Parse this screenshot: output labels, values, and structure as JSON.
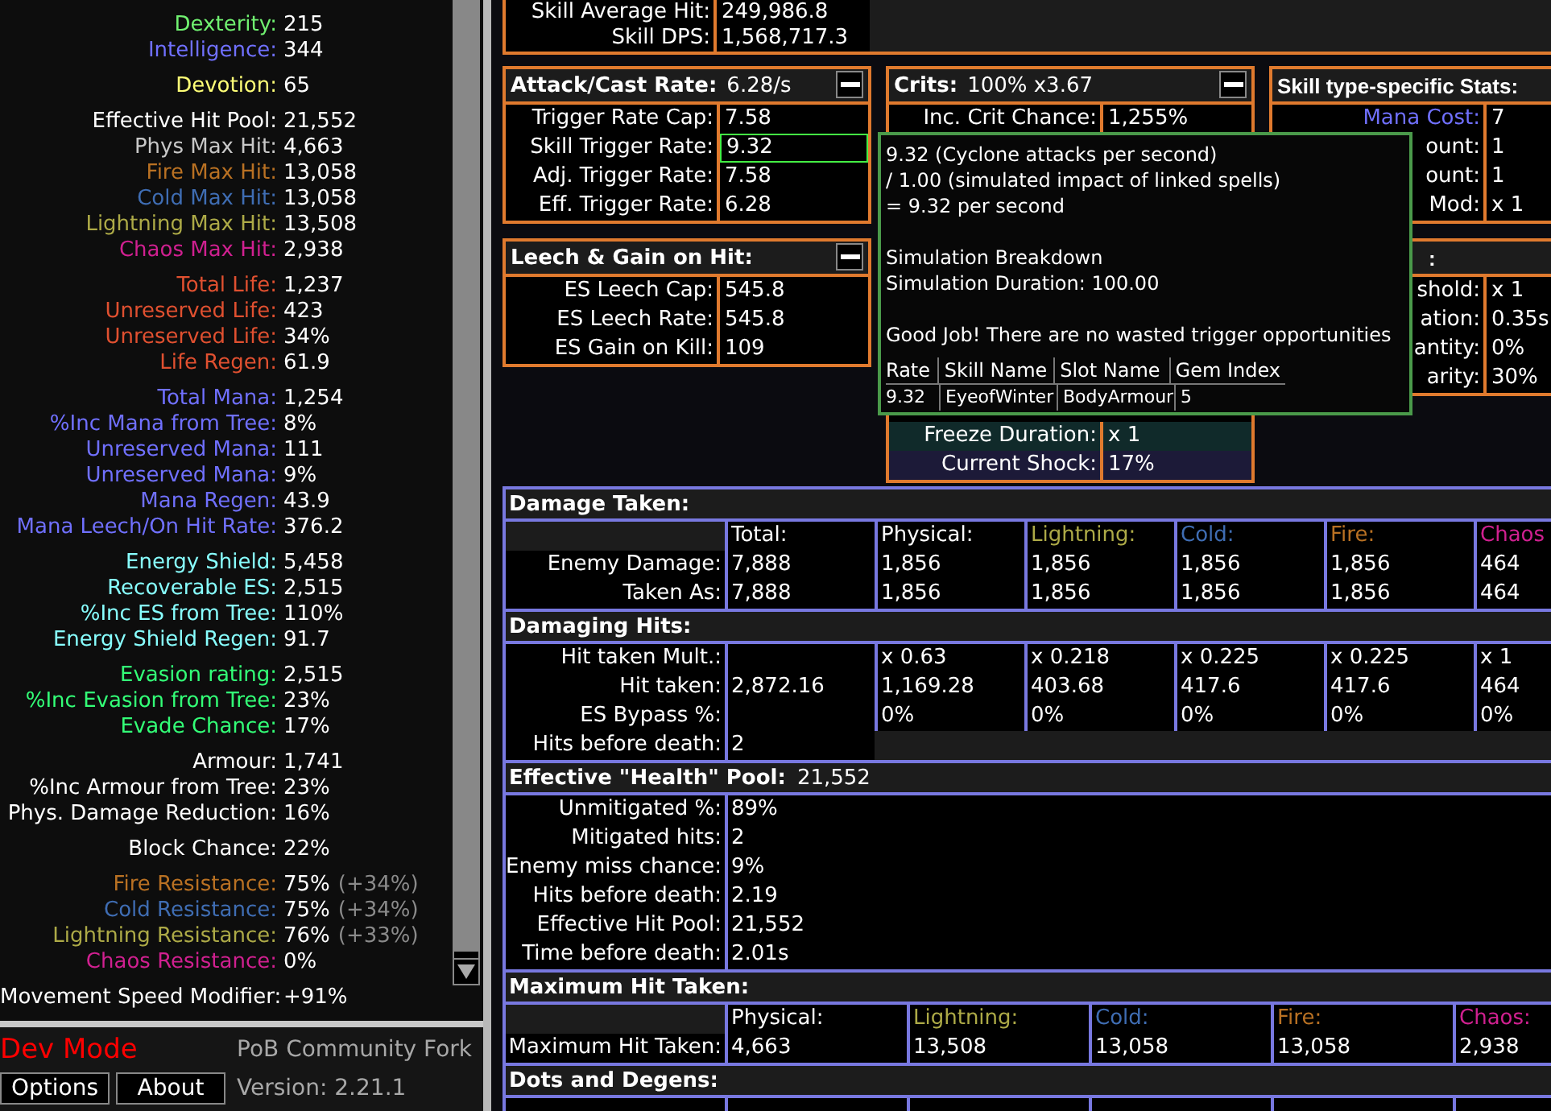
{
  "stats": {
    "groups": [
      {
        "rows": [
          {
            "label": "Dexterity:",
            "value": "215",
            "color": "#70f070"
          },
          {
            "label": "Intelligence:",
            "value": "344",
            "color": "#7070ff"
          }
        ]
      },
      {
        "rows": [
          {
            "label": "Devotion:",
            "value": "65",
            "color": "#ffff77"
          }
        ]
      },
      {
        "rows": [
          {
            "label": "Effective Hit Pool:",
            "value": "21,552",
            "color": "#ffffff"
          },
          {
            "label": "Phys Max Hit:",
            "value": "4,663",
            "color": "#c8c8c8"
          },
          {
            "label": "Fire Max Hit:",
            "value": "13,058",
            "color": "#b97123"
          },
          {
            "label": "Cold Max Hit:",
            "value": "13,058",
            "color": "#3f6db3"
          },
          {
            "label": "Lightning Max Hit:",
            "value": "13,508",
            "color": "#adaa47"
          },
          {
            "label": "Chaos Max Hit:",
            "value": "2,938",
            "color": "#d02090"
          }
        ]
      },
      {
        "rows": [
          {
            "label": "Total Life:",
            "value": "1,237",
            "color": "#e05030"
          },
          {
            "label": "Unreserved Life:",
            "value": "423",
            "color": "#e05030"
          },
          {
            "label": "Unreserved Life:",
            "value": "34%",
            "color": "#e05030"
          },
          {
            "label": "Life Regen:",
            "value": "61.9",
            "color": "#e05030"
          }
        ]
      },
      {
        "rows": [
          {
            "label": "Total Mana:",
            "value": "1,254",
            "color": "#7070ff"
          },
          {
            "label": "%Inc Mana from Tree:",
            "value": "8%",
            "color": "#7070ff"
          },
          {
            "label": "Unreserved Mana:",
            "value": "111",
            "color": "#7070ff"
          },
          {
            "label": "Unreserved Mana:",
            "value": "9%",
            "color": "#7070ff"
          },
          {
            "label": "Mana Regen:",
            "value": "43.9",
            "color": "#7070ff"
          },
          {
            "label": "Mana Leech/On Hit Rate:",
            "value": "376.2",
            "color": "#7070ff"
          }
        ]
      },
      {
        "rows": [
          {
            "label": "Energy Shield:",
            "value": "5,458",
            "color": "#88ffff"
          },
          {
            "label": "Recoverable ES:",
            "value": "2,515",
            "color": "#88ffff"
          },
          {
            "label": "%Inc ES from Tree:",
            "value": "110%",
            "color": "#88ffff"
          },
          {
            "label": "Energy Shield Regen:",
            "value": "91.7",
            "color": "#88ffff"
          }
        ]
      },
      {
        "rows": [
          {
            "label": "Evasion rating:",
            "value": "2,515",
            "color": "#33ff77"
          },
          {
            "label": "%Inc Evasion from Tree:",
            "value": "23%",
            "color": "#33ff77"
          },
          {
            "label": "Evade Chance:",
            "value": "17%",
            "color": "#33ff77"
          }
        ]
      },
      {
        "rows": [
          {
            "label": "Armour:",
            "value": "1,741",
            "color": "#ffffff"
          },
          {
            "label": "%Inc Armour from Tree:",
            "value": "23%",
            "color": "#ffffff"
          },
          {
            "label": "Phys. Damage Reduction:",
            "value": "16%",
            "color": "#ffffff"
          }
        ]
      },
      {
        "rows": [
          {
            "label": "Block Chance:",
            "value": "22%",
            "color": "#ffffff"
          }
        ]
      },
      {
        "rows": [
          {
            "label": "Fire Resistance:",
            "value": "75%",
            "extra": "(+34%)",
            "color": "#b97123"
          },
          {
            "label": "Cold Resistance:",
            "value": "75%",
            "extra": "(+34%)",
            "color": "#3f6db3"
          },
          {
            "label": "Lightning Resistance:",
            "value": "76%",
            "extra": "(+33%)",
            "color": "#adaa47"
          },
          {
            "label": "Chaos Resistance:",
            "value": "0%",
            "color": "#d02090"
          }
        ]
      },
      {
        "rows": [
          {
            "label": "Movement Speed Modifier:",
            "value": "+91%",
            "color": "#ffffff"
          }
        ]
      }
    ]
  },
  "footer": {
    "dev_mode": "Dev Mode",
    "fork": "PoB Community Fork",
    "version": "Version: 2.21.1",
    "buttons": [
      "Options",
      "About"
    ]
  },
  "top_box": {
    "rows": [
      {
        "label": "Skill Average Hit:",
        "value": "249,986.8"
      },
      {
        "label": "Skill DPS:",
        "value": "1,568,717.3"
      }
    ]
  },
  "calc_columns": [
    [
      {
        "kind": "stats",
        "title": "Attack/Cast Rate:",
        "title_value": "6.28/s",
        "collapsible": true,
        "rows": [
          {
            "label": "Trigger Rate Cap:",
            "value": "7.58",
            "highlighted": false
          },
          {
            "label": "Skill Trigger Rate:",
            "value": "9.32",
            "highlighted": true
          },
          {
            "label": "Adj. Trigger Rate:",
            "value": "7.58",
            "highlighted": false
          },
          {
            "label": "Eff. Trigger Rate:",
            "value": "6.28",
            "highlighted": false
          }
        ]
      },
      {
        "kind": "stats",
        "title": "Leech & Gain on Hit:",
        "collapsible": true,
        "rows": [
          {
            "label": "ES Leech Cap:",
            "value": "545.8",
            "highlighted": false
          },
          {
            "label": "ES Leech Rate:",
            "value": "545.8",
            "highlighted": false
          },
          {
            "label": "ES Gain on Kill:",
            "value": "109",
            "highlighted": false
          }
        ]
      }
    ],
    [
      {
        "kind": "stats",
        "title": "Crits:",
        "title_value": "100% x3.67",
        "collapsible": true,
        "rows": [
          {
            "label": "Inc. Crit Chance:",
            "value": "1,255%",
            "highlighted": false
          }
        ]
      },
      {
        "kind": "ailments",
        "rows": [
          {
            "label": "Freeze Duration:",
            "value": "x 1",
            "highlighted": false,
            "color": "#102a2a"
          },
          {
            "label": "Current Shock:",
            "value": "17%",
            "highlighted": false,
            "color": "#1c1a38"
          }
        ]
      }
    ],
    [
      {
        "kind": "stats",
        "title": "Skill type-specific Stats:",
        "rows": [
          {
            "label": "Mana Cost:",
            "value": "7",
            "highlighted": false,
            "color": "#7070ff"
          },
          {
            "label": "ount:",
            "value": "1",
            "highlighted": false
          },
          {
            "label": "ount:",
            "value": "1",
            "highlighted": false
          },
          {
            "label": "Mod:",
            "value": "x 1",
            "highlighted": false
          }
        ]
      },
      {
        "kind": "stats",
        "title": ":",
        "rows": [
          {
            "label": "shold:",
            "value": "x 1",
            "highlighted": false
          },
          {
            "label": "ation:",
            "value": "0.35s",
            "highlighted": false
          },
          {
            "label": "antity:",
            "value": "0%",
            "highlighted": false
          },
          {
            "label": "arity:",
            "value": "30%",
            "highlighted": false
          }
        ]
      }
    ]
  ],
  "tooltip": {
    "lines": [
      "9.32 (Cyclone attacks per second)",
      "/ 1.00 (simulated impact of linked spells)",
      "= 9.32 per second"
    ],
    "breakdown": [
      "Simulation Breakdown",
      "Simulation Duration: 100.00"
    ],
    "message": "Good Job! There are no wasted trigger opportunities",
    "table": {
      "columns": [
        "Rate",
        "Skill Name",
        "Slot Name",
        "Gem Index"
      ],
      "rows": [
        [
          "9.32",
          "EyeofWinter",
          "BodyArmour",
          "5"
        ]
      ]
    }
  },
  "defence": [
    {
      "title": "Damage Taken:",
      "kind": "grid",
      "columns": [
        {
          "label": "Total:"
        },
        {
          "label": "Physical:"
        },
        {
          "label": "Lightning:",
          "color": "#adaa47"
        },
        {
          "label": "Cold:",
          "color": "#3f6db3"
        },
        {
          "label": "Fire:",
          "color": "#b97123"
        },
        {
          "label": "Chaos",
          "color": "#d02090"
        }
      ],
      "rows": [
        {
          "label": "Enemy Damage:",
          "cells": [
            "7,888",
            "1,856",
            "1,856",
            "1,856",
            "1,856",
            "464"
          ]
        },
        {
          "label": "Taken As:",
          "cells": [
            "7,888",
            "1,856",
            "1,856",
            "1,856",
            "1,856",
            "464"
          ]
        }
      ]
    },
    {
      "title": "Damaging Hits:",
      "kind": "grid",
      "rows": [
        {
          "label": "Hit taken Mult.:",
          "cells": [
            null,
            "x 0.63",
            "x 0.218",
            "x 0.225",
            "x 0.225",
            "x 1"
          ]
        },
        {
          "label": "Hit taken:",
          "cells": [
            "2,872.16",
            "1,169.28",
            "403.68",
            "417.6",
            "417.6",
            "464"
          ]
        },
        {
          "label": "ES Bypass %:",
          "cells": [
            null,
            "0%",
            "0%",
            "0%",
            "0%",
            "0%"
          ]
        },
        {
          "label": "Hits before death:",
          "cells": [
            "2"
          ]
        }
      ]
    },
    {
      "title": "Effective \"Health\" Pool:",
      "title_value": "21,552",
      "kind": "list",
      "rows": [
        {
          "label": "Unmitigated %:",
          "value": "89%"
        },
        {
          "label": "Mitigated hits:",
          "value": "2"
        },
        {
          "label": "Enemy miss chance:",
          "value": "9%"
        },
        {
          "label": "Hits before death:",
          "value": "2.19"
        },
        {
          "label": "Effective Hit Pool:",
          "value": "21,552"
        },
        {
          "label": "Time before death:",
          "value": "2.01s"
        }
      ]
    },
    {
      "title": "Maximum Hit Taken:",
      "kind": "grid",
      "columns": [
        {
          "label": "Physical:"
        },
        {
          "label": "Lightning:",
          "color": "#adaa47"
        },
        {
          "label": "Cold:",
          "color": "#3f6db3"
        },
        {
          "label": "Fire:",
          "color": "#b97123"
        },
        {
          "label": "Chaos:",
          "color": "#d02090"
        }
      ],
      "rows": [
        {
          "label": "Maximum Hit Taken:",
          "cells": [
            "4,663",
            "13,508",
            "13,058",
            "13,058",
            "2,938"
          ]
        }
      ]
    },
    {
      "title": "Dots and Degens:",
      "kind": "stub"
    }
  ]
}
